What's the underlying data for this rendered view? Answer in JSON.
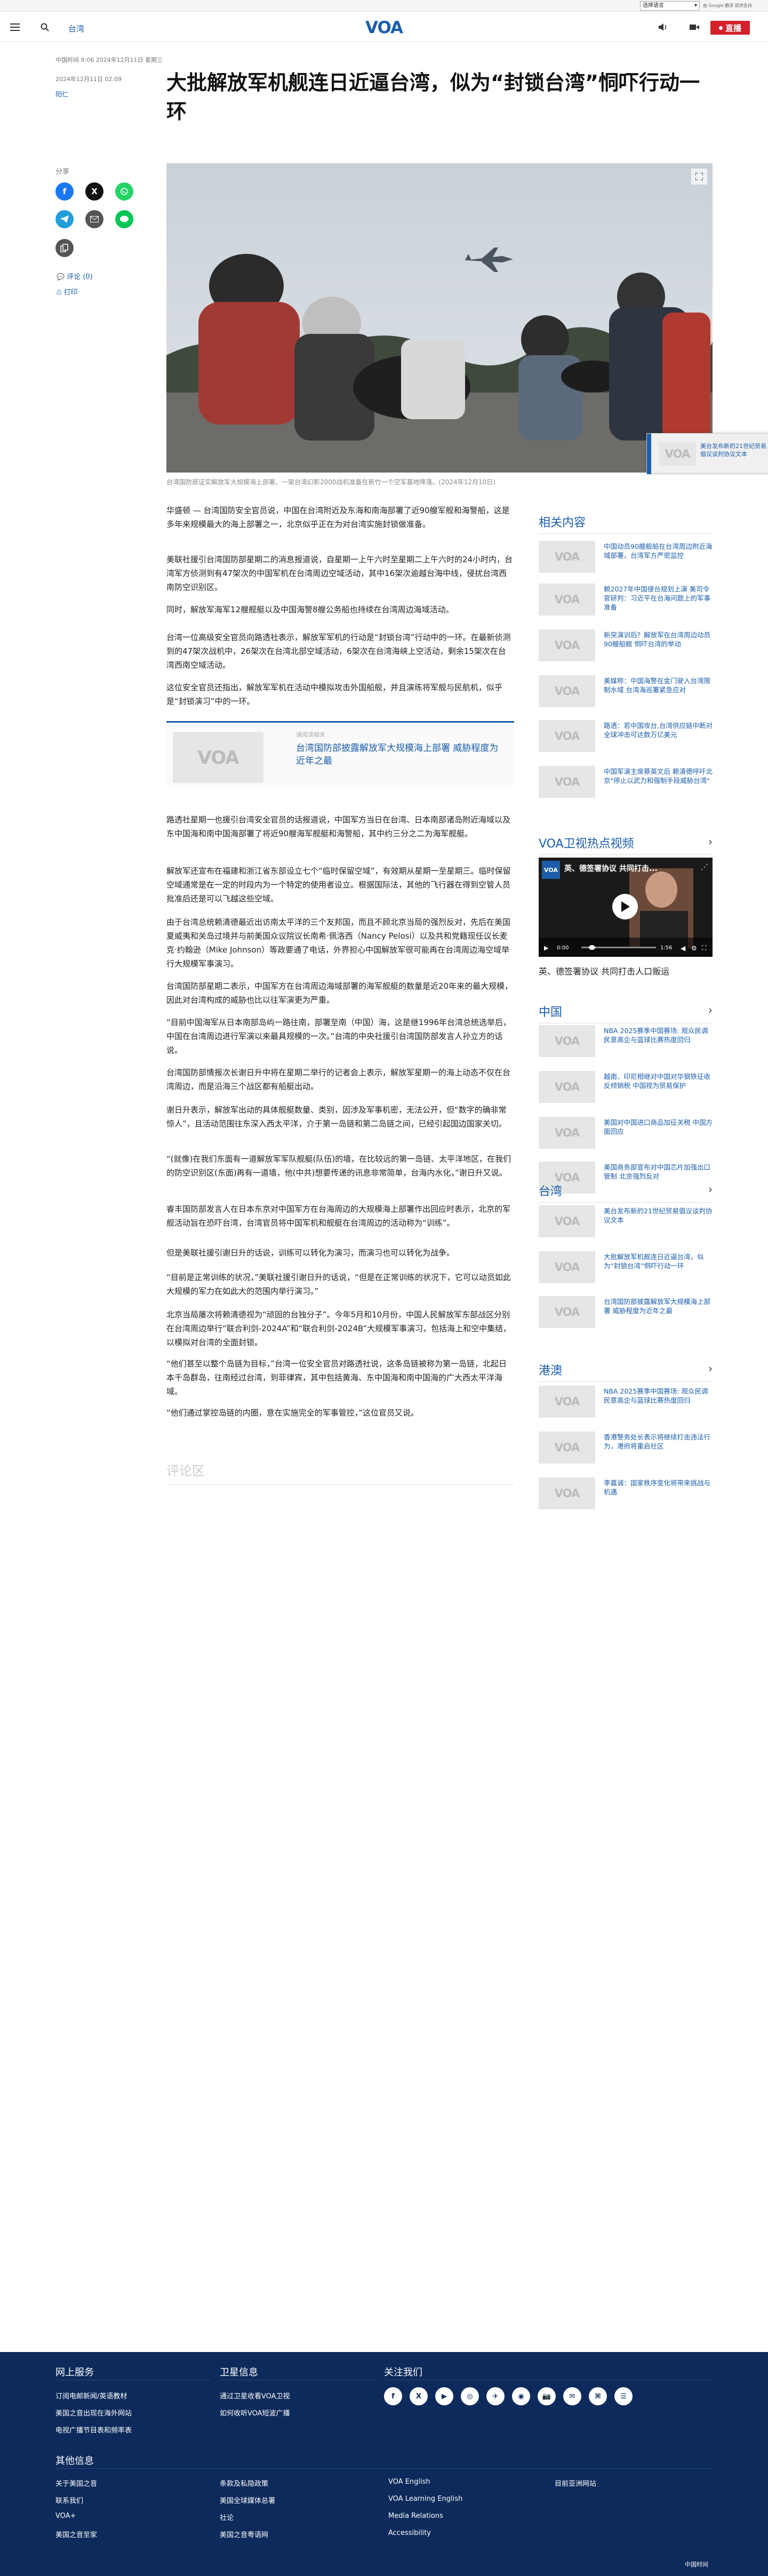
{
  "translate": {
    "select_label": "选择语言",
    "powered_by": "由 Google 翻译 提供支持"
  },
  "header": {
    "section": "台湾",
    "logo": "VOA",
    "live_label": "直播"
  },
  "article": {
    "meta_line": "中国时间 9:06 2024年12月11日 星期三",
    "date": "2024年12月11日 02:09",
    "author": "阳仁",
    "title": "大批解放军机舰连日近逼台湾，似为“封锁台湾”恫吓行动一环",
    "caption": "台湾国防部证实解放军大规模海上部署。一架台湾幻影2000战机准备在新竹一个空军基地降落。(2024年12月10日)",
    "share_label": "分享",
    "comments_link": "评论 (0)",
    "print_link": "打印",
    "paragraphs": [
      "华盛顿 — 台湾国防安全官员说，中国在台湾附近及东海和南海部署了近90艘军舰和海警船，这是多年来规模最大的海上部署之一，北京似乎正在为对台湾实施封锁做准备。",
      "美联社援引台湾国防部星期二的消息报道说，自星期一上午六时至星期二上午六时的24小时内，台湾军方侦测到有47架次的中国军机在台湾周边空域活动，其中16架次逾越台海中线，侵扰台湾西南防空识别区。",
      "同时，解放军海军12艘舰艇以及中国海警8艘公务船也持续在台湾周边海域活动。",
      "台湾一位高级安全官员向路透社表示，解放军军机的行动是“封锁台湾”行动中的一环。在最新侦测到的47架次战机中，26架次在台湾北部空域活动，6架次在台湾海峡上空活动，剩余15架次在台湾西南空域活动。",
      "这位安全官员还指出，解放军军机在活动中模拟攻击外国船舰，并且演练将军舰与民航机，似乎是“封锁演习”中的一环。",
      "路透社星期一也援引台湾安全官员的话报道说，中国军方当日在台湾、日本南部诸岛附近海域以及东中国海和南中国海部署了将近90艘海军舰艇和海警船，其中约三分之二为海军舰艇。",
      "解放军还宣布在福建和浙江省东部设立七个“临时保留空域”，有效期从星期一至星期三。临时保留空域通常是在一定的时段内为一个特定的使用者设立。根据国际法，其他的飞行器在得到空管人员批准后还是可以飞越这些空域。",
      "由于台湾总统赖清德最近出访南太平洋的三个友邦国，而且不顾北京当局的强烈反对，先后在美国夏威夷和关岛过境并与前美国众议院议长南希·佩洛西（Nancy Pelosi）以及共和党籍现任议长麦克·约翰逊（Mike Johnson）等政要通了电话，外界担心中国解放军很可能再在台湾周边海空域举行大规模军事演习。",
      "台湾国防部星期二表示，中国军方在台湾周边海域部署的海军舰艇的数量是近20年来的最大规模，因此对台湾构成的威胁也比以往军演更为严重。",
      "“目前中国海军从日本南部岛屿一路往南，部署至南（中国）海，这是继1996年台湾总统选举后，中国在台湾周边进行军演以来最具规模的一次。”台湾的中央社援引台湾国防部发言人孙立方的话说。",
      "台湾国防部情报次长谢日升中将在星期二举行的记者会上表示，解放军星期一的海上动态不仅在台湾周边，而是沿海三个战区都有船艇出动。",
      "谢日升表示，解放军出动的具体舰艇数量、类别，因涉及军事机密，无法公开，但“数字的确非常惊人”，且活动范围往东深入西太平洋，介于第一岛链和第二岛链之间，已经引起国边国家关切。",
      "“(就像)在我们东面有一道解放军军队舰艇(队伍)的墙，在比较远的第一岛链、太平洋地区，在我们的防空识别区(东面)再有一道墙，他(中共)想要传递的讯息非常简单，台海内水化，”谢日升又说。",
      "睿丰国防部发言人在日本东京对中国军方在台海周边的大规模海上部署作出回应时表示，北京的军舰活动旨在恐吓台湾，台湾官员将中国军机和舰艇在台湾周边的活动称为“训练”。",
      "但是美联社援引谢日升的话说，训练可以转化为演习，而演习也可以转化为战争。",
      "“目前是正常训练的状况，”美联社援引谢日升的话说，“但是在正常训练的状况下，它可以动员如此大规模的军力在如此大的范围内举行演习。”",
      "北京当局屡次将赖清德视为“顽固的台独分子”。今年5月和10月份，中国人民解放军东部战区分别在台湾周边举行“联合利剑-2024A”和“联合利剑-2024B”大规模军事演习，包括海上和空中集结，以模拟对台湾的全面封锁。",
      "“他们甚至以整个岛链为目标，”台湾一位安全官员对路透社说，这条岛链被称为第一岛链，北起日本千岛群岛，往南经过台湾，到菲律宾，其中包括黄海、东中国海和南中国海的广大西太平洋海域。",
      "“他们通过掌控岛链的内圈，意在实施完全的军事管控，”这位官员又说。"
    ],
    "related_label": "请阅读相关",
    "related_title": "台湾国防部披露解放军大规模海上部署 威胁程度为近年之最",
    "comments_heading": "评论区"
  },
  "float_card": {
    "text": "美台发布新的21世纪贸易倡议谈判协议文本"
  },
  "sidebar": {
    "related": {
      "heading": "相关内容",
      "items": [
        {
          "text": "中国动员90艘舰船在台湾周边附近海域部署，台湾军方严密监控"
        },
        {
          "text": "赖2027年中国侵台规划上演 美司令官研判：习近平在台海问题上的军事准备"
        },
        {
          "text": "新突演训后？解放军在台湾周边动员90艘船舰 恫吓台湾的举动"
        },
        {
          "text": "美媒称：中国海警在金门驶入台湾限制水域 台湾海巡署紧急应对"
        },
        {
          "text": "路透：若中国攻台,台湾供应链中断对全球冲击可达数万亿美元"
        },
        {
          "text": "中国军演主席蔡英文后 赖清德呼吁北京\"停止以武力和强制手段威胁台湾\""
        }
      ]
    },
    "video": {
      "heading": "VOA卫视热点视频",
      "title": "英、德签署协议 共同打击人口贩运",
      "overlay_title": "英、德签署协议 共同打击...",
      "time_current": "0:00",
      "time_total": "1:56"
    },
    "china": {
      "heading": "中国",
      "items": [
        {
          "text": "NBA 2025赛季中国赛场: 观众民调民意高企与篮球比赛热度回归"
        },
        {
          "text": "越南、印尼相继对中国对华钢铁征收反倾销税 中国视为贸易保护"
        },
        {
          "text": "美国对中国进口商品加征关税 中国方面回应"
        },
        {
          "text": "美国商务部宣布对中国芯片加强出口管制 北京强烈反对"
        }
      ]
    },
    "taiwan": {
      "heading": "台湾",
      "items": [
        {
          "text": "美台发布新的21世纪贸易倡议谈判协议文本"
        },
        {
          "text": "大批解放军机舰连日近逼台湾，似为“封锁台湾”恫吓行动一环"
        },
        {
          "text": "台湾国防部披露解放军大规模海上部署 威胁程度为近年之最"
        }
      ]
    },
    "hongkong": {
      "heading": "港澳",
      "items": [
        {
          "text": "NBA 2025赛季中国赛场: 观众民调民意高企与篮球比赛热度回归"
        },
        {
          "text": "香港警务处长表示将继续打击违法行为，港府将重启社区"
        },
        {
          "text": "李嘉诚：国家秩序变化将带来挑战与机遇"
        }
      ]
    }
  },
  "footer": {
    "col1_head": "网上服务",
    "col1_links": [
      "订阅电邮新闻/英语教材",
      "美国之音出现在海外网站",
      "电视广播节目表和频率表"
    ],
    "col2_head": "卫星信息",
    "col2_links": [
      "通过卫星收看VOA卫视",
      "如何收听VOA短波广播"
    ],
    "col3_head": "关注我们",
    "social_icons": [
      "f",
      "X",
      "▶",
      "◎",
      "✈",
      "◉",
      "📷",
      "✉",
      "⌘",
      "☰"
    ],
    "other_head": "其他信息",
    "other_links": [
      "关于美国之音",
      "条款及私隐政策",
      "VOA English",
      "目前亚洲网站",
      "联系我们",
      "美国全球媒体总署",
      "VOA Learning English",
      "VOA+",
      "社论",
      "Media Relations",
      "美国之音至家",
      "美国之音粤语网",
      "Accessibility"
    ],
    "bottom_right": "中国时间"
  }
}
